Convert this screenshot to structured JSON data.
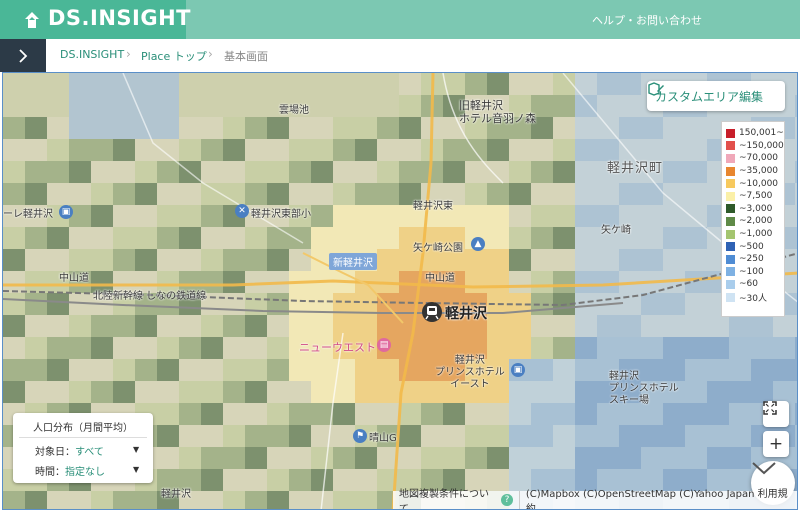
{
  "header": {
    "logo_text": "DS.INSIGHT",
    "help_link": "ヘルプ・お問い合わせ",
    "brand_color": "#4ab797"
  },
  "breadcrumb": {
    "items": [
      "DS.INSIGHT",
      "Place トップ",
      "基本画面"
    ]
  },
  "custom_area": {
    "label": "カスタムエリア編集"
  },
  "legend": {
    "items": [
      {
        "label": "150,001~",
        "color": "#c81e2a"
      },
      {
        "label": "~150,000",
        "color": "#e2504c"
      },
      {
        "label": "~70,000",
        "color": "#f0a8b9"
      },
      {
        "label": "~35,000",
        "color": "#e8862f"
      },
      {
        "label": "~10,000",
        "color": "#f7c95e"
      },
      {
        "label": "~7,500",
        "color": "#fbf0a8"
      },
      {
        "label": "~3,000",
        "color": "#2f5a2a"
      },
      {
        "label": "~2,000",
        "color": "#5f8a47"
      },
      {
        "label": "~1,000",
        "color": "#a4c56f"
      },
      {
        "label": "~500",
        "color": "#2f62b4"
      },
      {
        "label": "~250",
        "color": "#4f8cd4"
      },
      {
        "label": "~100",
        "color": "#7eb1e3"
      },
      {
        "label": "~60",
        "color": "#a9cdec"
      },
      {
        "label": "~30人",
        "color": "#cfe3f3"
      }
    ]
  },
  "info_panel": {
    "title": "人口分布（月間平均）",
    "date_label": "対象日：",
    "date_value": "すべて",
    "time_label": "時間：",
    "time_value": "指定なし"
  },
  "map": {
    "labels": {
      "station_main": "軽井沢",
      "station_new_tag": "新軽井沢",
      "town": "軽井沢町",
      "hotel_otowa": "旧軽井沢\nホテル音羽ノ森",
      "yagasaki_park": "矢ケ崎公園",
      "nakasendo_1": "中山道",
      "nakasendo_2": "中山道",
      "railway": "北陸新幹線 しなの鉄道線",
      "karuizawa_east": "軽井沢東",
      "east_school": "軽井沢東部小",
      "new_west": "ニューウエスト",
      "prince_east": "軽井沢\nプリンスホテル\nイースト",
      "prince_ski": "軽井沢\nプリンスホテル\nスキー場",
      "hareyama": "晴山G",
      "yagasaki": "矢ケ崎",
      "kumoba": "雲場池",
      "left_edge": "ーレ軽井沢",
      "bottom_left": "軽井沢"
    }
  },
  "attribution": {
    "terms": "地図複製条件について",
    "credits": "(C)Mapbox (C)OpenStreetMap (C)Yahoo Japan 利用規約"
  },
  "controls": {
    "zoom_in": "+",
    "zoom_out": "−"
  }
}
